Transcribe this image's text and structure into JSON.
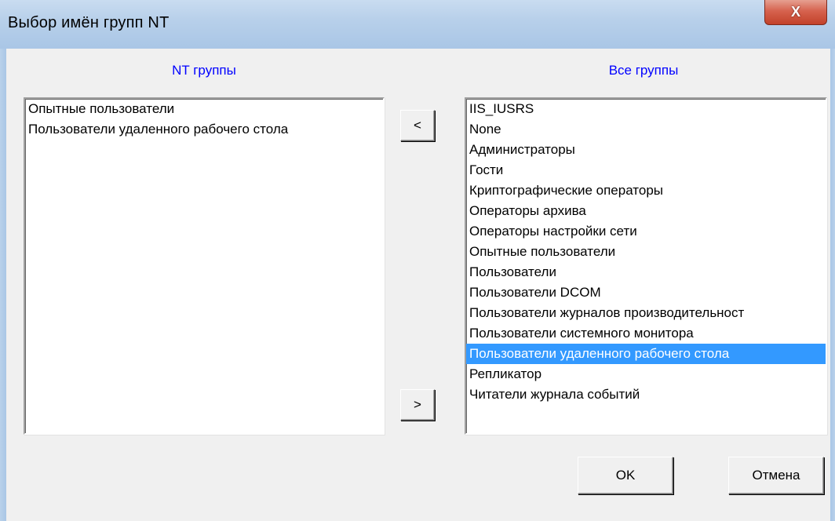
{
  "window": {
    "title": "Выбор имён групп NT",
    "close_glyph": "X"
  },
  "left_panel": {
    "label": "NT группы",
    "items": [
      "Опытные пользователи",
      "Пользователи удаленного рабочего стола"
    ]
  },
  "right_panel": {
    "label": "Все группы",
    "items": [
      "IIS_IUSRS",
      "None",
      "Администраторы",
      "Гости",
      "Криптографические операторы",
      "Операторы архива",
      "Операторы настройки сети",
      "Опытные пользователи",
      "Пользователи",
      "Пользователи DCOM",
      "Пользователи журналов производительност",
      "Пользователи системного монитора",
      "Пользователи удаленного рабочего стола",
      "Репликатор",
      "Читатели журнала событий"
    ],
    "selected_item": "Пользователи удаленного рабочего стола"
  },
  "buttons": {
    "move_left": "<",
    "move_right": ">",
    "ok": "OK",
    "cancel": "Отмена"
  },
  "colors": {
    "label_color": "#0000ff",
    "selection": "#3399ff",
    "titlebar": "#b8d0ea",
    "close_button": "#c94a35"
  }
}
